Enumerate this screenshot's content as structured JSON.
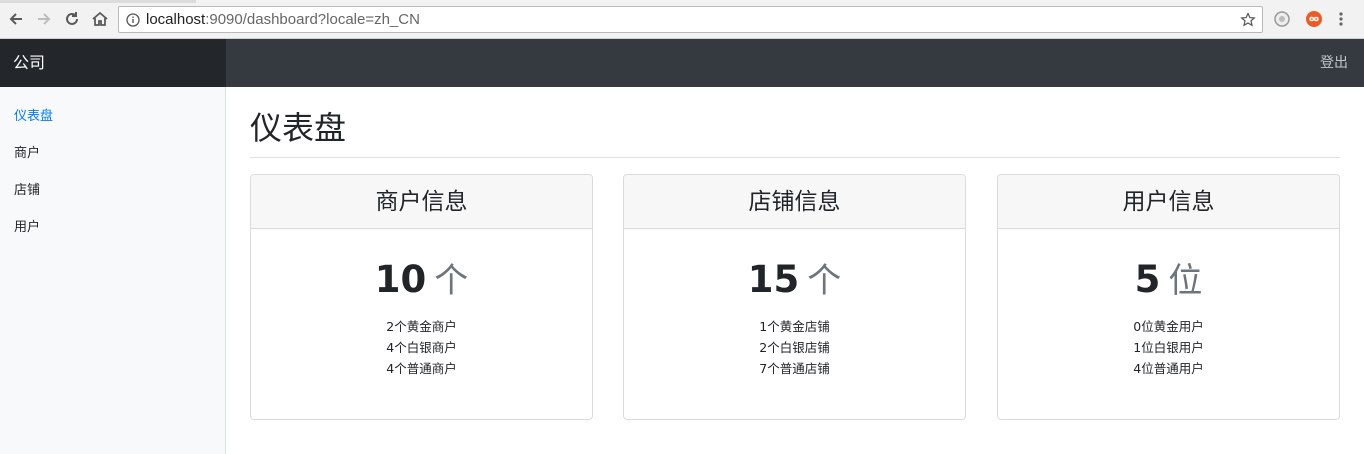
{
  "browser": {
    "url_host": "localhost",
    "url_path": ":9090/dashboard?locale=zh_CN"
  },
  "navbar": {
    "brand": "公司",
    "logout": "登出"
  },
  "sidebar": {
    "items": [
      {
        "label": "仪表盘",
        "active": true
      },
      {
        "label": "商户"
      },
      {
        "label": "店铺"
      },
      {
        "label": "用户"
      }
    ]
  },
  "main": {
    "title": "仪表盘",
    "cards": [
      {
        "title": "商户信息",
        "count": "10",
        "unit": "个",
        "lines": [
          "2个黄金商户",
          "4个白银商户",
          "4个普通商户"
        ]
      },
      {
        "title": "店铺信息",
        "count": "15",
        "unit": "个",
        "lines": [
          "1个黄金店铺",
          "2个白银店铺",
          "7个普通店铺"
        ]
      },
      {
        "title": "用户信息",
        "count": "5",
        "unit": "位",
        "lines": [
          "0位黄金用户",
          "1位白银用户",
          "4位普通用户"
        ]
      }
    ]
  },
  "colors": {
    "navbar": "#343a40",
    "brand_bg": "#23272b",
    "active_link": "#007bff",
    "unit_gray": "#6c757d"
  },
  "icons": [
    "back-arrow-icon",
    "forward-arrow-icon",
    "reload-icon",
    "home-icon",
    "info-icon",
    "bookmark-star-icon",
    "extension-icon",
    "extension-infinity-icon"
  ]
}
